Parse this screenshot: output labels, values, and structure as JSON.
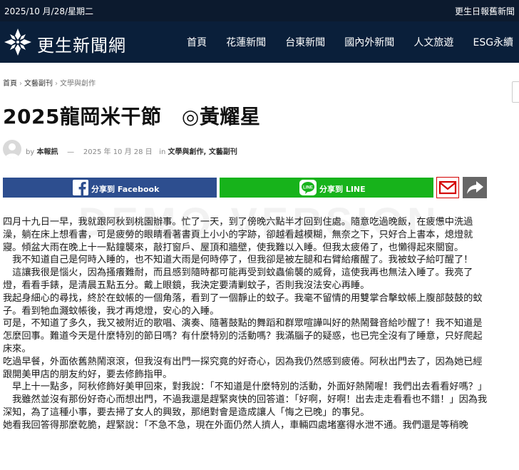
{
  "topbar": {
    "date": "2025/10 月/28/星期二",
    "paper_name": "更生日報舊新聞"
  },
  "header": {
    "site_name": "更生新聞網",
    "nav": [
      "首頁",
      "花蓮新聞",
      "台東新聞",
      "國內外新聞",
      "人文旅遊",
      "ESG永續"
    ]
  },
  "breadcrumb": {
    "home": "首頁",
    "section": "文藝副刊",
    "current": "文學與創作"
  },
  "article": {
    "title": "2025龍岡米干節　◎黃耀星",
    "author_prefix": "by",
    "author": "本報訊",
    "dash": "—",
    "date": "2025 年 10 月 28 日",
    "in_label": "in",
    "categories": "文學與創作, 文藝副刊",
    "paragraphs": [
      "四月十九日一早，我就跟阿秋到桃園辦事。忙了一天，到了傍晚六點半才回到住處。隨意吃過晚飯，在疲憊中洗過澡，躺在床上想看書，可是疲勞的眼睛看著書頁上小小的字跡，卻越看越模糊，無奈之下，只好合上書本，熄燈就寢。傾盆大雨在晚上十一點鐘襲來，敲打窗戶、屋頂和牆壁，使我難以入睡。但我太疲倦了，也懶得起來關窗。",
      "　我不知道自己是何時入睡的，也不知道大雨是何時停了，但我卻是被左腿和右臂給癢醒了。我被蚊子給叮醒了！",
      "　這讓我很是惱火，因為搔癢難耐，而且感到隨時都可能再受到蚊蟲偷襲的威脅，這使我再也無法入睡了。我亮了燈，看看手錶，是清晨五點五分。戴上眼鏡，我決定要清剿蚊子，否則我沒法安心再睡。",
      "我起身細心的尋找，終於在蚊帳的一個角落，看到了一個靜止的蚊子。我毫不留情的用雙掌合擊蚊帳上腹部鼓鼓的蚊子。看到牠血濺蚊帳後，我才再熄燈，安心的入睡。",
      "可是，不知道了多久，我又被附近的歌唱、演奏、隨著鼓點的舞蹈和群眾喧譁叫好的熱鬧聲音給吵醒了！我不知道是怎麼回事。難道今天是什麼特別的節日嗎？有什麼特別的活動嗎？我滿腦子的疑惑，也已完全沒有了睡意，只好爬起床來。",
      "吃過早餐，外面依舊熱鬧滾滾，但我沒有出門一探究竟的好奇心，因為我仍然感到疲倦。阿秋出門去了，因為她已經跟開美甲店的朋友約好，要去修飾指甲。",
      "　早上十一點多，阿秋修飾好美甲回來，對我說：「不知道是什麼特別的活動，外面好熱鬧喔！我們出去看看好嗎？」",
      "　我雖然並沒有那份好奇心而想出門，不過我還是趕緊爽快的回答道：「好啊，好啊！出去走走看看也不錯！」因為我深知，為了這種小事，要去掃了女人的興致，那絕對會是造成讓人「悔之已晚」的事兒。",
      "她看我回答得那麼乾脆，趕緊說：「不急不急，現在外面仍然人擠人，車輛四處堵塞得水泄不通。我們還是等稍晚"
    ]
  },
  "share": {
    "facebook": "分享到 Facebook",
    "line": "分享到 LINE"
  },
  "watermark": "DEMO VERSION",
  "colors": {
    "header_bg": "#0a1f3a",
    "facebook": "#2d4e8f",
    "line": "#17b31b",
    "mail": "#d40000"
  }
}
